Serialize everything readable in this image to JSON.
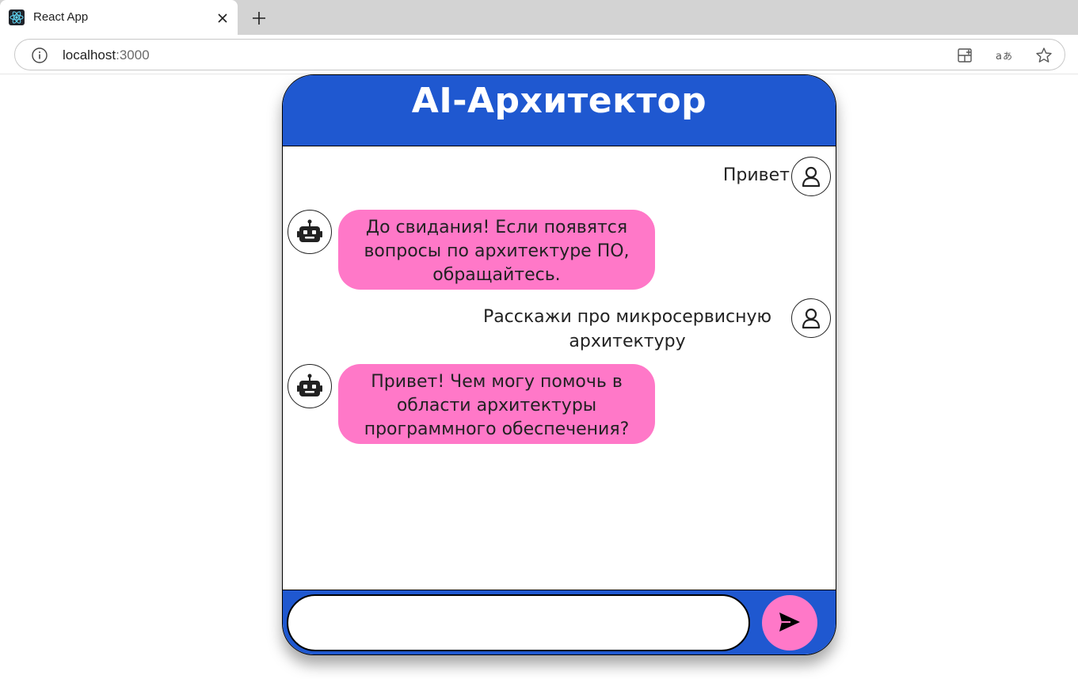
{
  "browser": {
    "tab_title": "React App",
    "url_host": "localhost",
    "url_port": ":3000"
  },
  "app": {
    "title": "AI-Архитектор",
    "accent_color": "#1f58d0",
    "bubble_color": "#ff78c8"
  },
  "messages": [
    {
      "role": "user",
      "text": "Привет"
    },
    {
      "role": "bot",
      "text": "До свидания! Если появятся вопросы по архитектуре ПО, обращайтесь."
    },
    {
      "role": "user",
      "text": "Расскажи про микросервисную архитектуру"
    },
    {
      "role": "bot",
      "text": "Привет! Чем могу помочь в области архитектуры программного обеспечения?"
    }
  ],
  "input": {
    "value": "",
    "placeholder": ""
  },
  "icons": {
    "user_avatar": "person-icon",
    "bot_avatar": "robot-icon",
    "send": "send-arrow-icon"
  }
}
